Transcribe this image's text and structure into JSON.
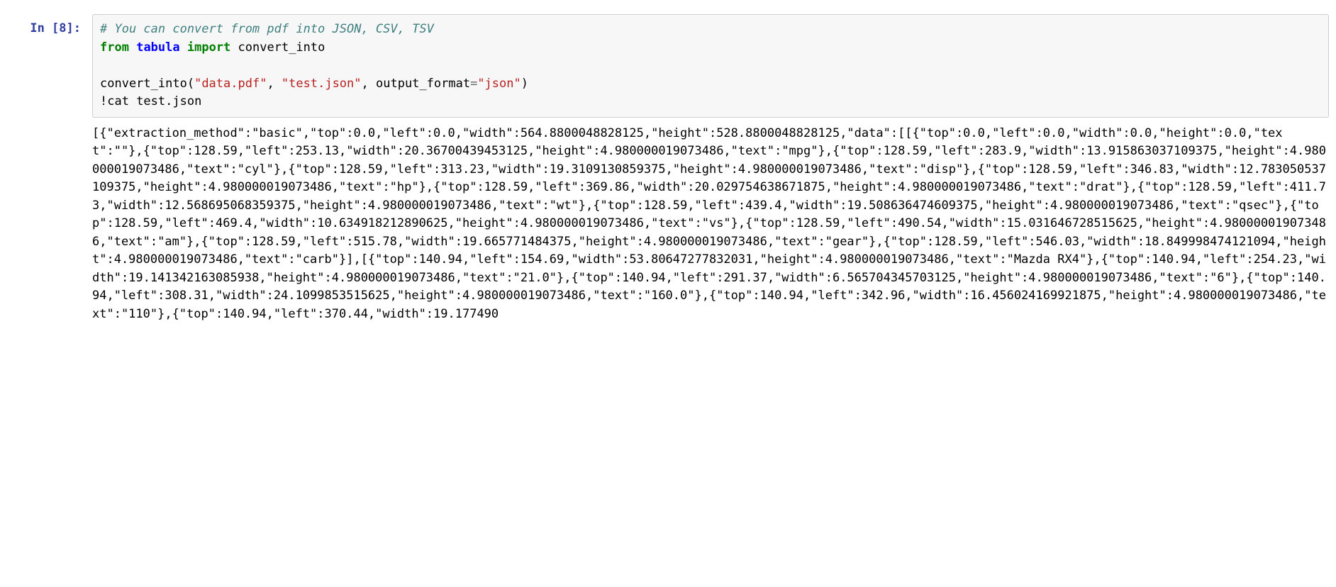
{
  "cell": {
    "prompt": "In [8]:",
    "code": {
      "comment": "# You can convert from pdf into JSON, CSV, TSV",
      "from": "from",
      "module": "tabula",
      "import": "import",
      "name_import": "convert_into",
      "call_fn": "convert_into",
      "paren_open": "(",
      "str1": "\"data.pdf\"",
      "comma1": ", ",
      "str2": "\"test.json\"",
      "comma2": ", ",
      "kw_name": "output_format",
      "eq": "=",
      "str3": "\"json\"",
      "paren_close": ")",
      "magic": "!",
      "magic_rest": "cat test.json"
    },
    "output": "[{\"extraction_method\":\"basic\",\"top\":0.0,\"left\":0.0,\"width\":564.8800048828125,\"height\":528.8800048828125,\"data\":[[{\"top\":0.0,\"left\":0.0,\"width\":0.0,\"height\":0.0,\"text\":\"\"},{\"top\":128.59,\"left\":253.13,\"width\":20.36700439453125,\"height\":4.980000019073486,\"text\":\"mpg\"},{\"top\":128.59,\"left\":283.9,\"width\":13.915863037109375,\"height\":4.980000019073486,\"text\":\"cyl\"},{\"top\":128.59,\"left\":313.23,\"width\":19.3109130859375,\"height\":4.980000019073486,\"text\":\"disp\"},{\"top\":128.59,\"left\":346.83,\"width\":12.783050537109375,\"height\":4.980000019073486,\"text\":\"hp\"},{\"top\":128.59,\"left\":369.86,\"width\":20.029754638671875,\"height\":4.980000019073486,\"text\":\"drat\"},{\"top\":128.59,\"left\":411.73,\"width\":12.568695068359375,\"height\":4.980000019073486,\"text\":\"wt\"},{\"top\":128.59,\"left\":439.4,\"width\":19.508636474609375,\"height\":4.980000019073486,\"text\":\"qsec\"},{\"top\":128.59,\"left\":469.4,\"width\":10.634918212890625,\"height\":4.980000019073486,\"text\":\"vs\"},{\"top\":128.59,\"left\":490.54,\"width\":15.031646728515625,\"height\":4.980000019073486,\"text\":\"am\"},{\"top\":128.59,\"left\":515.78,\"width\":19.665771484375,\"height\":4.980000019073486,\"text\":\"gear\"},{\"top\":128.59,\"left\":546.03,\"width\":18.849998474121094,\"height\":4.980000019073486,\"text\":\"carb\"}],[{\"top\":140.94,\"left\":154.69,\"width\":53.80647277832031,\"height\":4.980000019073486,\"text\":\"Mazda RX4\"},{\"top\":140.94,\"left\":254.23,\"width\":19.141342163085938,\"height\":4.980000019073486,\"text\":\"21.0\"},{\"top\":140.94,\"left\":291.37,\"width\":6.565704345703125,\"height\":4.980000019073486,\"text\":\"6\"},{\"top\":140.94,\"left\":308.31,\"width\":24.1099853515625,\"height\":4.980000019073486,\"text\":\"160.0\"},{\"top\":140.94,\"left\":342.96,\"width\":16.456024169921875,\"height\":4.980000019073486,\"text\":\"110\"},{\"top\":140.94,\"left\":370.44,\"width\":19.177490"
  }
}
